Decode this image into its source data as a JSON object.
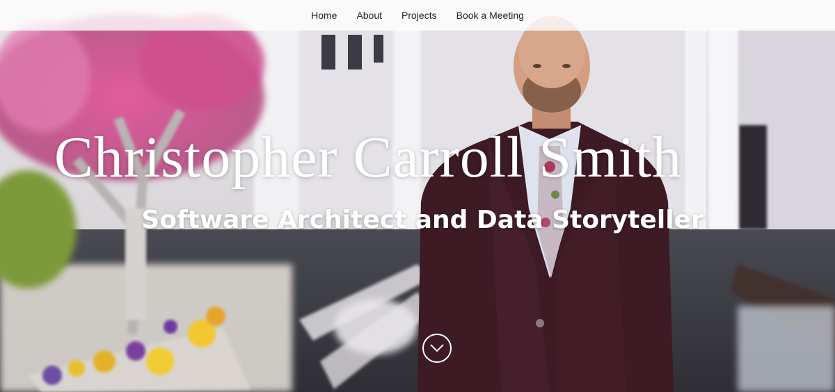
{
  "nav": {
    "items": [
      {
        "label": "Home"
      },
      {
        "label": "About"
      },
      {
        "label": "Projects"
      },
      {
        "label": "Book a Meeting"
      }
    ]
  },
  "hero": {
    "title": "Christopher Carroll Smith",
    "subtitle": "Software Architect and Data Storyteller",
    "scroll_icon": "chevron-down-circle-icon"
  },
  "colors": {
    "nav_bg": "#ffffffcc",
    "text": "#ffffff",
    "suit": "#3d1a24",
    "blossoms": "#d2558f"
  }
}
